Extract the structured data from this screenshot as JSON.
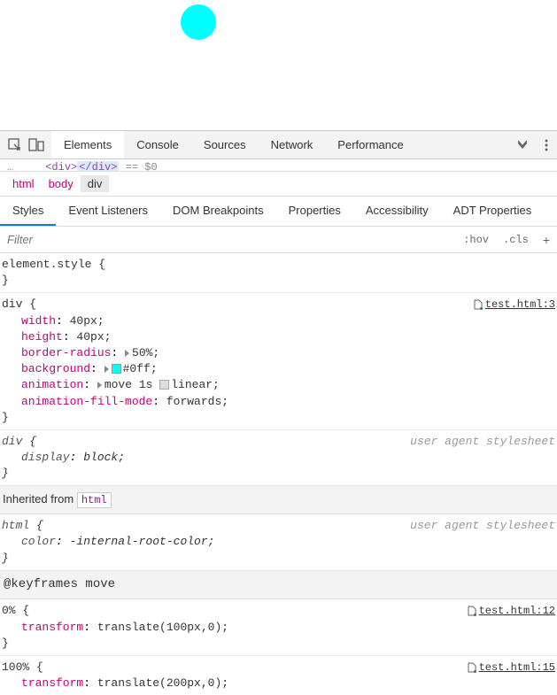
{
  "tabs": {
    "elements": "Elements",
    "console": "Console",
    "sources": "Sources",
    "network": "Network",
    "performance": "Performance"
  },
  "dom": {
    "ellipsis": "…",
    "open_tag": "<div>",
    "close_tag": "</div>",
    "eq_marker": " == $0"
  },
  "breadcrumb": {
    "html": "html",
    "body": "body",
    "div": "div"
  },
  "subtabs": {
    "styles": "Styles",
    "event_listeners": "Event Listeners",
    "dom_breakpoints": "DOM Breakpoints",
    "properties": "Properties",
    "accessibility": "Accessibility",
    "adt_properties": "ADT Properties"
  },
  "filter": {
    "placeholder": "Filter",
    "hov": ":hov",
    "cls": ".cls"
  },
  "rules": {
    "element_style": {
      "selector": "element.style",
      "brace_open": " {",
      "brace_close": "}"
    },
    "div_rule": {
      "selector": "div",
      "source": "test.html:3",
      "props": {
        "width": {
          "name": "width",
          "value": " 40px;"
        },
        "height": {
          "name": "height",
          "value": " 40px;"
        },
        "border_radius": {
          "name": "border-radius",
          "value": "50%;"
        },
        "background": {
          "name": "background",
          "value": "#0ff;"
        },
        "animation": {
          "name": "animation",
          "move": "move 1s ",
          "timing": "linear;"
        },
        "fill_mode": {
          "name": "animation-fill-mode",
          "value": " forwards;"
        }
      }
    },
    "div_ua": {
      "selector": "div",
      "source": "user agent stylesheet",
      "display_name": "display",
      "display_value": " block;"
    },
    "inherited": {
      "label": "Inherited from ",
      "tag": "html"
    },
    "html_ua": {
      "selector": "html",
      "source": "user agent stylesheet",
      "color_name": "color",
      "color_value": " -internal-root-color;"
    },
    "keyframes": {
      "label": "@keyframes move",
      "frame_0": {
        "selector": "0%",
        "source": "test.html:12",
        "transform_name": "transform",
        "transform_value": " translate(100px,0);"
      },
      "frame_100": {
        "selector": "100%",
        "source": "test.html:15",
        "transform_name": "transform",
        "transform_value": " translate(200px,0);"
      }
    }
  },
  "colors": {
    "accent": "#00ffff"
  }
}
